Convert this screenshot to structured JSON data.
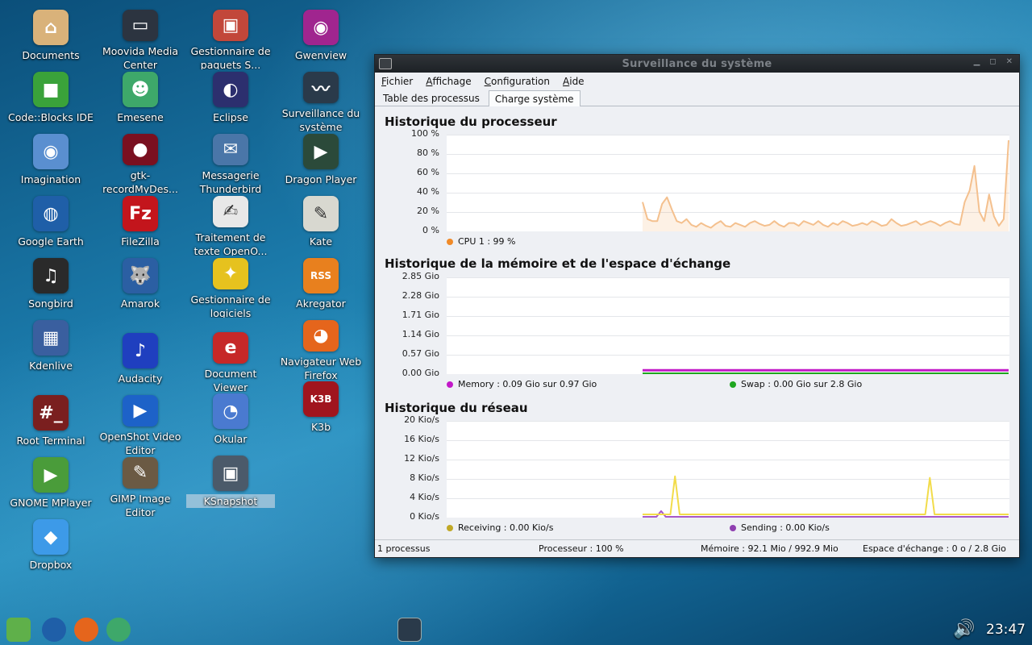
{
  "desktop": {
    "icons": [
      {
        "label": "Documents",
        "icon": "home-icon",
        "color": "#d9b27a",
        "glyph": "⌂"
      },
      {
        "label": "Code::Blocks IDE",
        "icon": "codeblocks-icon",
        "color": "#3aa23a",
        "glyph": "■"
      },
      {
        "label": "Imagination",
        "icon": "imagination-icon",
        "color": "#5a8fd0",
        "glyph": "◉"
      },
      {
        "label": "Google Earth",
        "icon": "google-earth-icon",
        "color": "#1f5fa8",
        "glyph": "◍"
      },
      {
        "label": "Songbird",
        "icon": "songbird-icon",
        "color": "#2a2a2a",
        "glyph": "♫"
      },
      {
        "label": "Kdenlive",
        "icon": "kdenlive-icon",
        "color": "#3a5f9f",
        "glyph": "▦"
      },
      {
        "label": "Root Terminal",
        "icon": "terminal-icon",
        "color": "#7a1f1f",
        "glyph": "#_"
      },
      {
        "label": "GNOME MPlayer",
        "icon": "mplayer-icon",
        "color": "#4a9c3a",
        "glyph": "▶"
      },
      {
        "label": "Dropbox",
        "icon": "dropbox-icon",
        "color": "#3d9ae8",
        "glyph": "◆"
      },
      {
        "label": "Moovida Media Center",
        "icon": "moovida-icon",
        "color": "#2c3440",
        "glyph": "▭"
      },
      {
        "label": "Emesene",
        "icon": "emesene-icon",
        "color": "#3ea86a",
        "glyph": "☻"
      },
      {
        "label": "gtk-recordMyDes...",
        "icon": "recordmydesktop-icon",
        "color": "#7a1020",
        "glyph": "●"
      },
      {
        "label": "FileZilla",
        "icon": "filezilla-icon",
        "color": "#c3151c",
        "glyph": "Fz"
      },
      {
        "label": "Amarok",
        "icon": "amarok-icon",
        "color": "#2b5fa3",
        "glyph": "🐺"
      },
      {
        "label": "Audacity",
        "icon": "audacity-icon",
        "color": "#1f3fbf",
        "glyph": "♪"
      },
      {
        "label": "OpenShot Video Editor",
        "icon": "openshot-icon",
        "color": "#1d62c8",
        "glyph": "▶"
      },
      {
        "label": "GIMP Image Editor",
        "icon": "gimp-icon",
        "color": "#6b5a44",
        "glyph": "✎"
      },
      {
        "label": "Gestionnaire de paquets S...",
        "icon": "package-manager-icon",
        "color": "#c2473a",
        "glyph": "▣"
      },
      {
        "label": "Eclipse",
        "icon": "eclipse-icon",
        "color": "#2c2f6e",
        "glyph": "◐"
      },
      {
        "label": "Messagerie Thunderbird",
        "icon": "thunderbird-icon",
        "color": "#4a76a8",
        "glyph": "✉"
      },
      {
        "label": "Traitement de texte OpenO...",
        "icon": "openoffice-writer-icon",
        "color": "#e8e8e8",
        "glyph": "✍"
      },
      {
        "label": "Gestionnaire de logiciels",
        "icon": "software-manager-icon",
        "color": "#e6c21e",
        "glyph": "✦"
      },
      {
        "label": "Document Viewer",
        "icon": "document-viewer-icon",
        "color": "#c62828",
        "glyph": "e"
      },
      {
        "label": "Okular",
        "icon": "okular-icon",
        "color": "#4a7ad0",
        "glyph": "◔"
      },
      {
        "label": "KSnapshot",
        "icon": "ksnapshot-icon",
        "color": "#4b5a6a",
        "glyph": "▣"
      },
      {
        "label": "Gwenview",
        "icon": "gwenview-icon",
        "color": "#a0258f",
        "glyph": "◉"
      },
      {
        "label": "Surveillance du système",
        "icon": "system-monitor-icon",
        "color": "#2a3a4a",
        "glyph": "〰"
      },
      {
        "label": "Dragon Player",
        "icon": "dragon-player-icon",
        "color": "#2b4a3a",
        "glyph": "▶"
      },
      {
        "label": "Kate",
        "icon": "kate-icon",
        "color": "#d8d8d0",
        "glyph": "✎"
      },
      {
        "label": "Akregator",
        "icon": "akregator-icon",
        "color": "#e8801e",
        "glyph": "RSS"
      },
      {
        "label": "Navigateur Web Firefox",
        "icon": "firefox-icon",
        "color": "#e5651c",
        "glyph": "◕"
      },
      {
        "label": "K3b",
        "icon": "k3b-icon",
        "color": "#a0151e",
        "glyph": "K3B"
      }
    ]
  },
  "window": {
    "title": "Surveillance du système",
    "controls": [
      "minimize-icon",
      "maximize-icon",
      "close-icon"
    ],
    "menu": [
      "Fichier",
      "Affichage",
      "Configuration",
      "Aide"
    ],
    "tabs": [
      {
        "label": "Table des processus",
        "active": false
      },
      {
        "label": "Charge système",
        "active": true
      }
    ],
    "cpu": {
      "title": "Historique du processeur",
      "ticks": [
        "100 %",
        "80 %",
        "60 %",
        "40 %",
        "20 %",
        "0 %"
      ],
      "legend": {
        "label": "CPU 1 : 99 %",
        "color": "#f08a28"
      }
    },
    "memory": {
      "title": "Historique de la mémoire et de l'espace d'échange",
      "ticks": [
        "2.85 Gio",
        "2.28 Gio",
        "1.71 Gio",
        "1.14 Gio",
        "0.57 Gio",
        "0.00 Gio"
      ],
      "legend": [
        {
          "label": "Memory : 0.09 Gio sur 0.97 Gio",
          "color": "#c218c8"
        },
        {
          "label": "Swap : 0.00 Gio sur 2.8 Gio",
          "color": "#1fa61f"
        }
      ]
    },
    "network": {
      "title": "Historique du réseau",
      "ticks": [
        "20 Kio/s",
        "16 Kio/s",
        "12 Kio/s",
        "8 Kio/s",
        "4 Kio/s",
        "0 Kio/s"
      ],
      "legend": [
        {
          "label": "Receiving : 0.00 Kio/s",
          "color": "#c0a826"
        },
        {
          "label": "Sending : 0.00 Kio/s",
          "color": "#8f3fb0"
        }
      ]
    },
    "status": {
      "processes": "1 processus",
      "cpu": "Processeur : 100 %",
      "memory": "Mémoire : 92.1 Mio / 992.9 Mio",
      "swap": "Espace d'échange : 0 o / 2.8 Gio"
    }
  },
  "chart_data": [
    {
      "type": "area",
      "title": "Historique du processeur",
      "ylim": [
        0,
        100
      ],
      "series": [
        {
          "name": "CPU 1",
          "color": "#f08a28",
          "values": [
            30,
            12,
            10,
            10,
            28,
            35,
            22,
            10,
            8,
            12,
            6,
            4,
            8,
            5,
            3,
            7,
            10,
            5,
            4,
            8,
            6,
            4,
            8,
            10,
            7,
            5,
            6,
            10,
            6,
            4,
            8,
            8,
            5,
            10,
            8,
            6,
            10,
            6,
            4,
            8,
            6,
            10,
            8,
            5,
            6,
            8,
            6,
            10,
            8,
            5,
            6,
            12,
            8,
            5,
            6,
            8,
            10,
            6,
            8,
            10,
            8,
            5,
            8,
            10,
            7,
            6,
            30,
            42,
            68,
            20,
            10,
            38,
            15,
            5,
            12,
            95
          ]
        }
      ]
    },
    {
      "type": "line",
      "title": "Historique de la mémoire et de l'espace d'échange",
      "ylim": [
        0,
        2.85
      ],
      "series": [
        {
          "name": "Memory",
          "color": "#c218c8",
          "values": [
            0.09,
            0.09,
            0.09,
            0.09,
            0.09,
            0.09,
            0.09,
            0.09,
            0.09,
            0.09
          ]
        },
        {
          "name": "Swap",
          "color": "#1fa61f",
          "values": [
            0.0,
            0.0,
            0.0,
            0.0,
            0.0,
            0.0,
            0.0,
            0.0,
            0.0,
            0.0
          ]
        }
      ]
    },
    {
      "type": "line",
      "title": "Historique du réseau",
      "ylim": [
        0,
        20
      ],
      "series": [
        {
          "name": "Receiving",
          "color": "#f2dc4a",
          "values": [
            0.5,
            0.5,
            0.5,
            0.5,
            0.5,
            0.5,
            0.5,
            8.5,
            0.5,
            0.5,
            0.5,
            0.5,
            0.5,
            0.5,
            0.5,
            0.5,
            0.5,
            0.5,
            0.5,
            0.5,
            0.5,
            0.5,
            0.5,
            0.5,
            0.5,
            0.5,
            0.5,
            0.5,
            0.5,
            0.5,
            0.5,
            0.5,
            0.5,
            0.5,
            0.5,
            0.5,
            0.5,
            0.5,
            0.5,
            0.5,
            0.5,
            0.5,
            0.5,
            0.5,
            0.5,
            0.5,
            0.5,
            0.5,
            0.5,
            0.5,
            0.5,
            0.5,
            0.5,
            0.5,
            0.5,
            0.5,
            0.5,
            0.5,
            0.5,
            0.5,
            0.5,
            0.5,
            8.2,
            0.5,
            0.5,
            0.5,
            0.5,
            0.5,
            0.5,
            0.5,
            0.5,
            0.5,
            0.5,
            0.5,
            0.5,
            0.5,
            0.5,
            0.5,
            0.5,
            0.5
          ]
        },
        {
          "name": "Sending",
          "color": "#a857c8",
          "values": [
            0,
            0,
            0,
            0,
            1.2,
            0,
            0,
            0,
            0,
            0,
            0,
            0,
            0,
            0,
            0,
            0,
            0,
            0,
            0,
            0,
            0,
            0,
            0,
            0,
            0,
            0,
            0,
            0,
            0,
            0,
            0,
            0,
            0,
            0,
            0,
            0,
            0,
            0,
            0,
            0,
            0,
            0,
            0,
            0,
            0,
            0,
            0,
            0,
            0,
            0,
            0,
            0,
            0,
            0,
            0,
            0,
            0,
            0,
            0,
            0,
            0,
            0,
            0,
            0,
            0,
            0,
            0,
            0,
            0,
            0,
            0,
            0,
            0,
            0,
            0,
            0,
            0,
            0,
            0,
            0
          ]
        }
      ]
    }
  ],
  "taskbar": {
    "launchers": [
      {
        "icon": "mint-menu-icon",
        "color": "#5fb04a"
      },
      {
        "icon": "google-earth-icon",
        "color": "#1f5fa8"
      },
      {
        "icon": "firefox-icon",
        "color": "#e5651c"
      },
      {
        "icon": "emesene-icon",
        "color": "#3ea86a"
      }
    ],
    "running": [
      {
        "icon": "system-monitor-icon",
        "color": "#2a3a4a"
      }
    ],
    "clock": "23:47",
    "volume_icon": "speaker-icon"
  }
}
